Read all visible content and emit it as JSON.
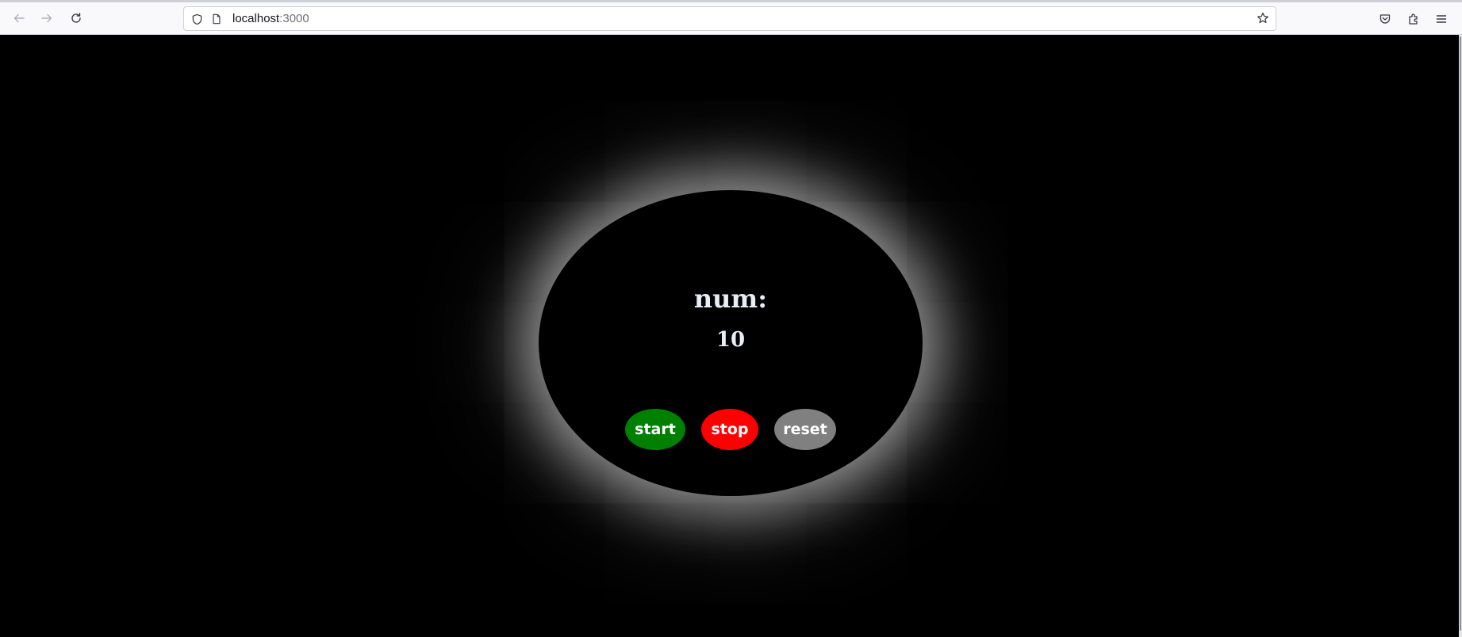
{
  "browser": {
    "url_host": "localhost",
    "url_port": ":3000",
    "icons": {
      "back": "arrow-left-icon",
      "forward": "arrow-right-icon",
      "reload": "reload-icon",
      "shield": "shield-icon",
      "page": "page-icon",
      "bookmark": "star-icon",
      "pocket": "pocket-icon",
      "extensions": "extensions-icon",
      "menu": "hamburger-menu-icon"
    }
  },
  "app": {
    "title": "num:",
    "value": "10",
    "buttons": {
      "start": "start",
      "stop": "stop",
      "reset": "reset"
    },
    "colors": {
      "background": "#000000",
      "start": "#008000",
      "stop": "#ff0000",
      "reset": "#808080",
      "glow": "#ffffff"
    }
  }
}
